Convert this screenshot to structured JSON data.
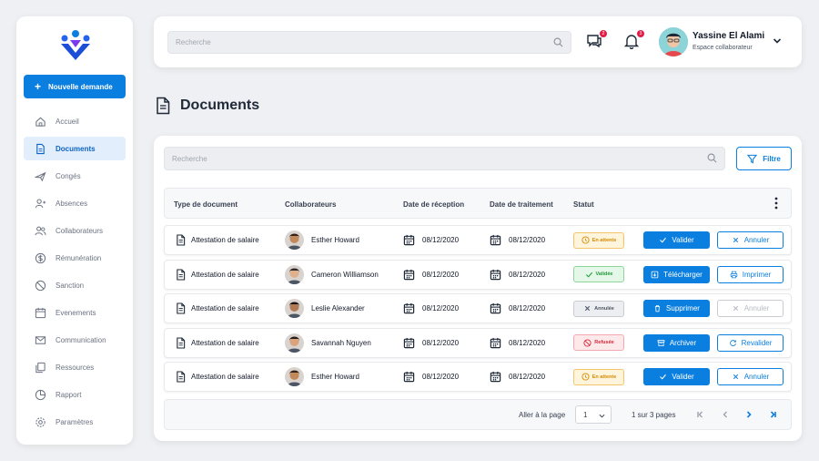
{
  "sidebar": {
    "new_request": "Nouvelle demande",
    "items": [
      {
        "label": "Accueil",
        "icon": "home-icon"
      },
      {
        "label": "Documents",
        "icon": "document-icon",
        "active": true
      },
      {
        "label": "Congés",
        "icon": "plane-icon"
      },
      {
        "label": "Absences",
        "icon": "user-absent-icon"
      },
      {
        "label": "Collaborateurs",
        "icon": "users-icon"
      },
      {
        "label": "Rémunération",
        "icon": "dollar-icon"
      },
      {
        "label": "Sanction",
        "icon": "ban-icon"
      },
      {
        "label": "Evenements",
        "icon": "calendar-icon"
      },
      {
        "label": "Communication",
        "icon": "mail-icon"
      },
      {
        "label": "Ressources",
        "icon": "files-icon"
      },
      {
        "label": "Rapport",
        "icon": "pie-chart-icon"
      },
      {
        "label": "Paramètres",
        "icon": "gear-icon"
      }
    ]
  },
  "header": {
    "search_placeholder": "Recherche",
    "messages_count": "2",
    "notifications_count": "3",
    "user_name": "Yassine El Alami",
    "user_role": "Espace collaborateur"
  },
  "page": {
    "title": "Documents"
  },
  "documents": {
    "search_placeholder": "Recherche",
    "filter_label": "Filtre",
    "columns": [
      "Type de document",
      "Collaborateurs",
      "Date de réception",
      "Date de traitement",
      "Statut"
    ],
    "rows": [
      {
        "type": "Attestation de salaire",
        "collaborator": "Esther Howard",
        "received": "08/12/2020",
        "processed": "08/12/2020",
        "status": "En attente",
        "status_kind": "wait",
        "primary": "Valider",
        "primary_icon": "check-icon",
        "secondary": "Annuler",
        "secondary_icon": "x-icon",
        "secondary_disabled": false
      },
      {
        "type": "Attestation de salaire",
        "collaborator": "Cameron Williamson",
        "received": "08/12/2020",
        "processed": "08/12/2020",
        "status": "Validée",
        "status_kind": "ok",
        "primary": "Télécharger",
        "primary_icon": "download-icon",
        "secondary": "Imprimer",
        "secondary_icon": "printer-icon",
        "secondary_disabled": false
      },
      {
        "type": "Attestation de salaire",
        "collaborator": "Leslie Alexander",
        "received": "08/12/2020",
        "processed": "08/12/2020",
        "status": "Annulée",
        "status_kind": "cancel",
        "primary": "Supprimer",
        "primary_icon": "trash-icon",
        "secondary": "Annuler",
        "secondary_icon": "x-icon",
        "secondary_disabled": true
      },
      {
        "type": "Attestation de salaire",
        "collaborator": "Savannah Nguyen",
        "received": "08/12/2020",
        "processed": "08/12/2020",
        "status": "Refusée",
        "status_kind": "ref",
        "primary": "Archiver",
        "primary_icon": "archive-icon",
        "secondary": "Revalider",
        "secondary_icon": "refresh-icon",
        "secondary_disabled": false
      },
      {
        "type": "Attestation de salaire",
        "collaborator": "Esther Howard",
        "received": "08/12/2020",
        "processed": "08/12/2020",
        "status": "En attente",
        "status_kind": "wait",
        "primary": "Valider",
        "primary_icon": "check-icon",
        "secondary": "Annuler",
        "secondary_icon": "x-icon",
        "secondary_disabled": false
      }
    ],
    "pagination": {
      "per_page_label": "Aller à la page",
      "current_page": "1",
      "info": "1 sur 3 pages"
    }
  },
  "colors": {
    "primary": "#0b7fe0",
    "sidebar_active_bg": "#e3eefc",
    "badge": "#e11d48"
  }
}
